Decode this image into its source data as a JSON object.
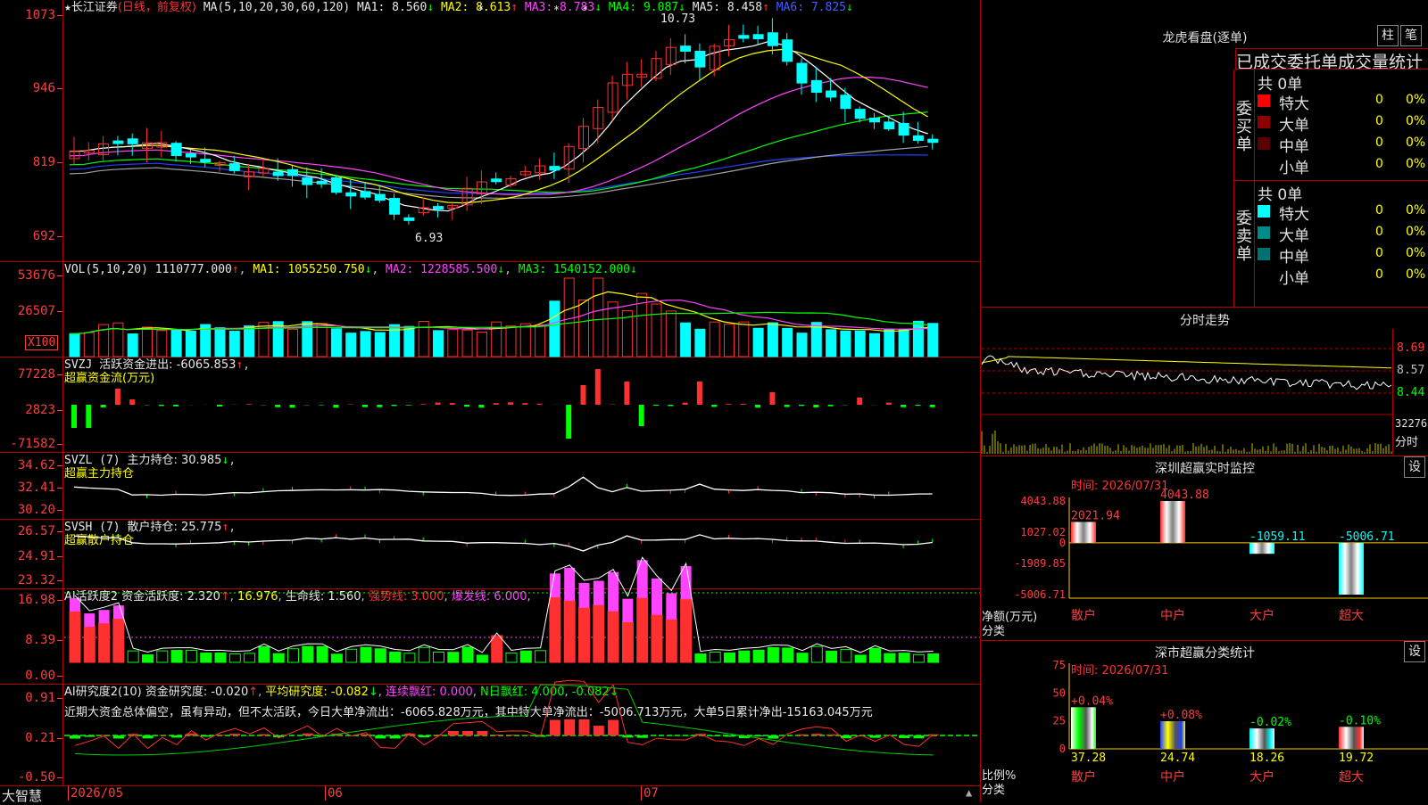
{
  "colors": {
    "up": "#ff3030",
    "down": "#00ffff",
    "grid": "#b00000",
    "ma1": "#ffffff",
    "ma2": "#ffff00",
    "ma3": "#ff44ff",
    "ma4": "#00ff00",
    "ma5": "#a0a0a0",
    "ma6": "#2040ff"
  },
  "main": {
    "star": "★",
    "stock": "长江证券",
    "mode": "(日线，前复权)",
    "ma_label": "MA(5,10,20,30,60,120)",
    "ma1": "MA1: 8.560",
    "ma1_arrow": "↓",
    "ma2": "MA2: 8.613",
    "ma2_arrow": "↑",
    "ma3": "MA3: 8.783",
    "ma3_arrow": "↓",
    "ma4": "MA4: 9.087",
    "ma4_arrow": "↓",
    "ma5": "MA5: 8.458",
    "ma5_arrow": "↑",
    "ma6": "MA6: 7.825",
    "ma6_arrow": "↓",
    "yticks": [
      "1073",
      "946",
      "819",
      "692"
    ],
    "high_label": "10.73",
    "low_label": "6.93",
    "marks": [
      "*",
      "*",
      "*"
    ]
  },
  "vol": {
    "label": "VOL(5,10,20)",
    "value": "1110777.000",
    "arrow": "↑",
    "ma1": "MA1: 1055250.750",
    "ma1_arrow": "↓",
    "ma2": "MA2: 1228585.500",
    "ma2_arrow": "↓",
    "ma3": "MA3: 1540152.000",
    "ma3_arrow": "↓",
    "yticks": [
      "53676",
      "26507"
    ],
    "unit": "X100"
  },
  "svzj": {
    "label": "SVZJ",
    "title": "活跃资金进出: -6065.853",
    "arrow": "↑",
    "sub": "超赢资金流(万元)",
    "yticks": [
      "77228",
      "2823",
      "-71582"
    ]
  },
  "svzl": {
    "label": "SVZL (7)",
    "title": "主力持仓: 30.985",
    "arrow": "↓",
    "sub": "超赢主力持仓",
    "yticks": [
      "34.62",
      "32.41",
      "30.20"
    ]
  },
  "svsh": {
    "label": "SVSH (7)",
    "title": "散户持仓: 25.775",
    "arrow": "↑",
    "sub": "超赢散户持仓",
    "yticks": [
      "26.57",
      "24.91",
      "23.32"
    ]
  },
  "ai1": {
    "label": "AI活跃度2",
    "title": "资金活跃度: 2.320",
    "arrow": "↑",
    "v2": "16.976",
    "life": "生命线: 1.560",
    "strong": "强势线: 3.000",
    "burst": "爆发线: 6.000",
    "yticks": [
      "16.98",
      "8.39",
      "0.00"
    ]
  },
  "ai2": {
    "label": "AI研究度2(10)",
    "title": "资金研究度: -0.020",
    "arrow": "↑",
    "avg": "平均研究度: -0.082",
    "avg_arrow": "↓",
    "red": "连续飘红: 0.000",
    "nred": "N日飘红: 4.000",
    "last": "-0.082",
    "last_arrow": "↓",
    "comment": "近期大资金总体偏空，虽有异动，但不太活跃，今日大单净流出：-6065.828万元，其中特大单净流出：-5006.713万元，大单5日累计净出-15163.045万元",
    "yticks": [
      "0.91",
      "0.21",
      "-0.50"
    ]
  },
  "xaxis": {
    "app": "大智慧",
    "labels": [
      "2026/05",
      "06",
      "07"
    ]
  },
  "lhb": {
    "title": "龙虎看盘(逐单)",
    "btn1": "柱",
    "btn2": "笔",
    "subtitle": "已成交委托单成交量统计",
    "buy": {
      "label": "委买单",
      "total": "共 0单",
      "rows": [
        {
          "name": "特大",
          "v": "0",
          "p": "0%",
          "color": "#ff0000"
        },
        {
          "name": "大单",
          "v": "0",
          "p": "0%",
          "color": "#8b0000"
        },
        {
          "name": "中单",
          "v": "0",
          "p": "0%",
          "color": "#5a0000"
        },
        {
          "name": "小单",
          "v": "0",
          "p": "0%",
          "color": "#000000"
        }
      ]
    },
    "sell": {
      "label": "委卖单",
      "total": "共 0单",
      "rows": [
        {
          "name": "特大",
          "v": "0",
          "p": "0%",
          "color": "#00ffff"
        },
        {
          "name": "大单",
          "v": "0",
          "p": "0%",
          "color": "#008b8b"
        },
        {
          "name": "中单",
          "v": "0",
          "p": "0%",
          "color": "#007070"
        },
        {
          "name": "小单",
          "v": "0",
          "p": "0%",
          "color": "#000000"
        }
      ]
    }
  },
  "intraday": {
    "title": "分时走势",
    "yticks": [
      "8.69",
      "8.57",
      "8.44"
    ],
    "vol_label": "32276",
    "unit": "分时"
  },
  "monitor": {
    "title": "深圳超赢实时监控",
    "btn": "设",
    "time": "时间: 2026/07/31",
    "yticks": [
      "4043.88",
      "1027.02",
      "0",
      "-1989.85",
      "-5006.71"
    ],
    "ylabel": "净额(万元)",
    "xlabel": "分类",
    "chart_data": {
      "type": "bar",
      "categories": [
        "散户",
        "中户",
        "大户",
        "超大"
      ],
      "values": [
        2021.94,
        4043.88,
        -1059.11,
        -5006.71
      ],
      "labels": [
        "2021.94",
        "4043.88",
        "-1059.11",
        "-5006.71"
      ],
      "ylim": [
        -5006.71,
        4043.88
      ]
    }
  },
  "stats": {
    "title": "深市超赢分类统计",
    "btn": "设",
    "time": "时间: 2026/07/31",
    "yticks": [
      "75",
      "50",
      "25",
      "0"
    ],
    "ylabel": "比例%",
    "xlabel": "分类",
    "chart_data": {
      "type": "bar",
      "categories": [
        "散户",
        "中户",
        "大户",
        "超大"
      ],
      "values": [
        37.28,
        24.74,
        18.26,
        19.72
      ],
      "changes": [
        "+0.04%",
        "+0.08%",
        "-0.02%",
        "-0.10%"
      ],
      "ylim": [
        0,
        75
      ]
    }
  }
}
